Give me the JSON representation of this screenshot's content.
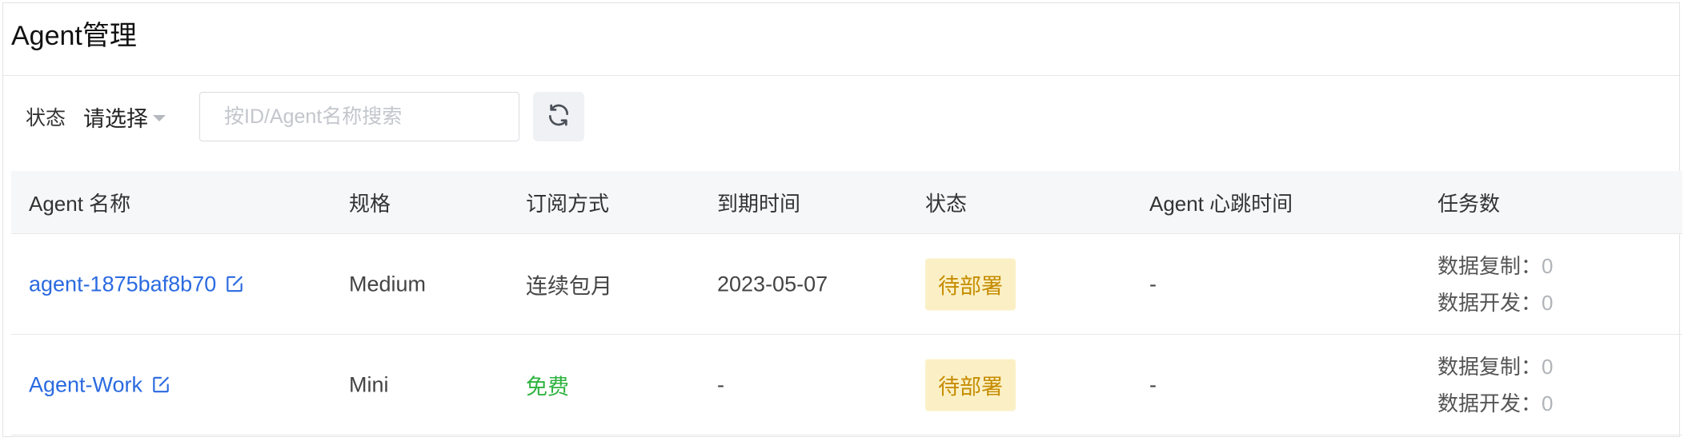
{
  "page": {
    "title": "Agent管理"
  },
  "filters": {
    "status_label": "状态",
    "status_select_value": "请选择",
    "search_placeholder": "按ID/Agent名称搜索",
    "refresh_icon": "refresh-icon"
  },
  "table": {
    "columns": [
      "Agent 名称",
      "规格",
      "订阅方式",
      "到期时间",
      "状态",
      "Agent 心跳时间",
      "任务数"
    ],
    "rows": [
      {
        "name": "agent-1875baf8b70",
        "spec": "Medium",
        "subscription": "连续包月",
        "expiry": "2023-05-07",
        "status": "待部署",
        "heartbeat": "-",
        "task_copy_label": "数据复制：",
        "task_copy_count": "0",
        "task_dev_label": "数据开发：",
        "task_dev_count": "0"
      },
      {
        "name": "Agent-Work",
        "spec": "Mini",
        "subscription": "免费",
        "expiry": "-",
        "status": "待部署",
        "heartbeat": "-",
        "task_copy_label": "数据复制：",
        "task_copy_count": "0",
        "task_dev_label": "数据开发：",
        "task_dev_count": "0"
      }
    ]
  },
  "colors": {
    "link": "#2a6ae0",
    "free": "#2fb33f",
    "badge_bg": "#fbf0c5",
    "badge_text": "#c68c00"
  }
}
